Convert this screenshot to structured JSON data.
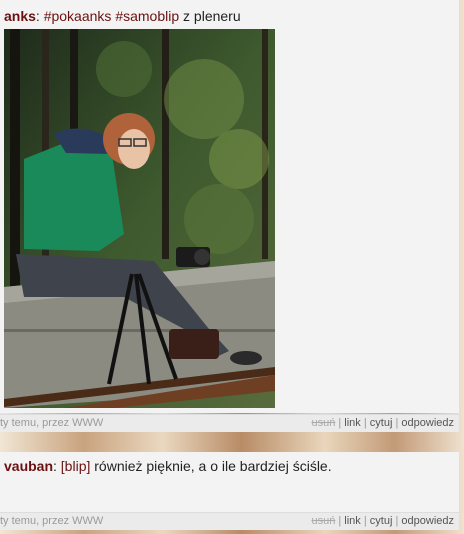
{
  "post1": {
    "author": "anks",
    "separator": ":",
    "tags": [
      "#pokaanks",
      "#samoblip"
    ],
    "text": "z pleneru",
    "meta_left": "ty temu, przez WWW",
    "actions": {
      "delete": "usuń",
      "link": "link",
      "quote": "cytuj",
      "reply": "odpowiedz"
    },
    "action_sep": "|"
  },
  "post2": {
    "author": "vauban",
    "separator": ":",
    "tag": "[blip]",
    "text": "również pięknie, a o ile bardziej ściśle.",
    "meta_left": "ty temu, przez WWW",
    "actions": {
      "delete": "usuń",
      "link": "link",
      "quote": "cytuj",
      "reply": "odpowiedz"
    },
    "action_sep": "|"
  },
  "colors": {
    "author": "#6b1111",
    "post_bg": "#f3f3f3",
    "meta_bg": "#ebebeb"
  }
}
